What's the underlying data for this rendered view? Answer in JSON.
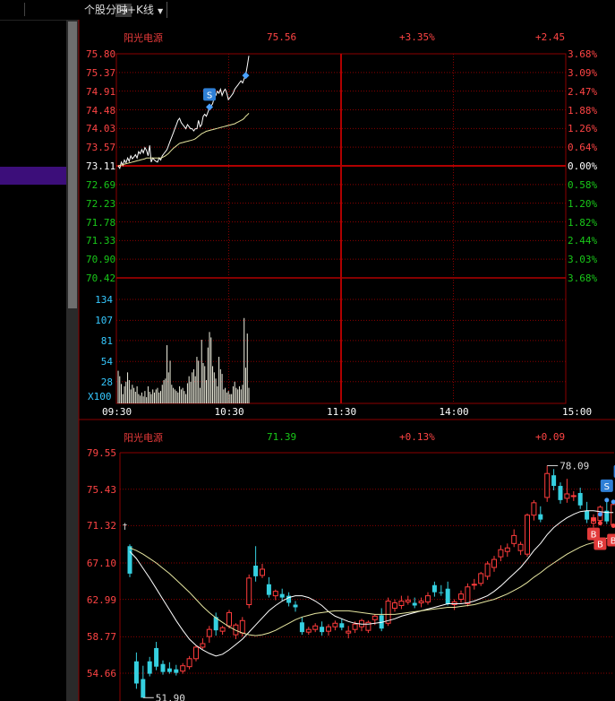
{
  "toolbar": {
    "toggle_icon": "panel-toggle-icon",
    "title": "个股分时+K线",
    "dropdown_icon": "chevron-down-icon"
  },
  "intraday": {
    "stock_name": "阳光电源",
    "price": "75.56",
    "change_pct": "+3.35%",
    "change_abs": "+2.45",
    "price_ticks": [
      "75.80",
      "75.37",
      "74.91",
      "74.48",
      "74.03",
      "73.57",
      "73.11",
      "72.69",
      "72.23",
      "71.78",
      "71.33",
      "70.90",
      "70.42"
    ],
    "pct_ticks": [
      "3.68%",
      "3.09%",
      "2.47%",
      "1.88%",
      "1.26%",
      "0.64%",
      "0.00%",
      "0.58%",
      "1.20%",
      "1.82%",
      "2.44%",
      "3.03%",
      "3.68%"
    ],
    "volume_ticks": [
      "134",
      "107",
      "81",
      "54",
      "28"
    ],
    "volume_unit": "X100",
    "time_ticks": [
      "09:30",
      "10:30",
      "11:30",
      "14:00",
      "15:00"
    ],
    "sell_marker": "S",
    "price_line": [
      73.11,
      73.05,
      73.2,
      73.12,
      73.25,
      73.18,
      73.3,
      73.22,
      73.35,
      73.28,
      73.32,
      73.38,
      73.3,
      73.45,
      73.4,
      73.5,
      73.42,
      73.55,
      73.48,
      73.35,
      73.6,
      73.2,
      73.3,
      73.25,
      73.22,
      73.2,
      73.3,
      73.25,
      73.35,
      73.4,
      73.45,
      73.5,
      73.6,
      73.7,
      73.8,
      73.9,
      74.0,
      74.1,
      74.2,
      74.25,
      74.15,
      74.1,
      74.05,
      74.0,
      74.1,
      74.05,
      74.0,
      74.0,
      73.95,
      74.0,
      74.0,
      74.2,
      74.05,
      74.1,
      74.3,
      74.35,
      74.3,
      74.4,
      74.5,
      74.55,
      74.6,
      74.75,
      74.8,
      74.9,
      74.85,
      74.95,
      74.8,
      74.9,
      74.95,
      74.85,
      74.7,
      74.75,
      74.8,
      74.85,
      74.95,
      75.0,
      75.05,
      75.1,
      75.15,
      75.1,
      75.2,
      75.3,
      75.5,
      75.75
    ],
    "avg_line": [
      73.11,
      73.12,
      73.13,
      73.14,
      73.15,
      73.16,
      73.17,
      73.18,
      73.19,
      73.2,
      73.21,
      73.22,
      73.23,
      73.24,
      73.25,
      73.26,
      73.27,
      73.28,
      73.3,
      73.3,
      73.3,
      73.3,
      73.3,
      73.3,
      73.3,
      73.3,
      73.3,
      73.3,
      73.31,
      73.33,
      73.35,
      73.38,
      73.41,
      73.45,
      73.49,
      73.53,
      73.56,
      73.59,
      73.62,
      73.65,
      73.66,
      73.67,
      73.68,
      73.69,
      73.7,
      73.71,
      73.72,
      73.73,
      73.74,
      73.76,
      73.79,
      73.82,
      73.85,
      73.88,
      73.9,
      73.92,
      73.94,
      73.95,
      73.96,
      73.97,
      73.98,
      73.99,
      74.0,
      74.01,
      74.02,
      74.03,
      74.04,
      74.05,
      74.06,
      74.07,
      74.08,
      74.09,
      74.1,
      74.11,
      74.12,
      74.14,
      74.16,
      74.18,
      74.2,
      74.22,
      74.25,
      74.3,
      74.33,
      74.37
    ],
    "volumes": [
      42,
      35,
      25,
      12,
      22,
      28,
      40,
      30,
      18,
      24,
      20,
      15,
      22,
      12,
      10,
      14,
      9,
      16,
      8,
      22,
      15,
      12,
      18,
      14,
      18,
      20,
      14,
      16,
      24,
      30,
      32,
      75,
      40,
      55,
      24,
      20,
      18,
      16,
      14,
      22,
      18,
      20,
      16,
      12,
      26,
      35,
      28,
      40,
      44,
      35,
      60,
      55,
      20,
      82,
      52,
      48,
      30,
      72,
      92,
      85,
      48,
      40,
      32,
      22,
      60,
      44,
      38,
      18,
      20,
      14,
      16,
      12,
      12,
      22,
      28,
      20,
      18,
      22,
      18,
      24,
      110,
      46,
      90,
      20
    ]
  },
  "kline": {
    "stock_name": "阳光电源",
    "price": "71.39",
    "change_pct": "+0.13%",
    "change_abs": "+0.09",
    "price_ticks": [
      "79.55",
      "75.43",
      "71.32",
      "67.10",
      "62.99",
      "58.77",
      "54.66"
    ],
    "high_label": "78.09",
    "low_label": "51.90",
    "buy_marker": "B",
    "sell_marker": "S",
    "candles": [
      [
        69.0,
        69.2,
        65.9,
        65.5
      ],
      [
        56.0,
        57.0,
        53.5,
        52.9
      ],
      [
        54.0,
        55.5,
        51.9,
        51.9
      ],
      [
        56.0,
        56.5,
        54.6,
        54.3
      ],
      [
        57.5,
        58.2,
        55.4,
        55.0
      ],
      [
        55.7,
        56.1,
        54.8,
        54.5
      ],
      [
        55.2,
        55.9,
        54.8,
        54.6
      ],
      [
        55.1,
        55.6,
        54.7,
        54.4
      ],
      [
        54.9,
        55.8,
        55.5,
        54.6
      ],
      [
        55.4,
        56.6,
        56.3,
        55.1
      ],
      [
        56.3,
        57.8,
        57.6,
        56.0
      ],
      [
        57.6,
        58.6,
        58.0,
        57.4
      ],
      [
        58.8,
        60.0,
        59.6,
        58.1
      ],
      [
        61.0,
        61.5,
        59.5,
        58.9
      ],
      [
        59.4,
        60.0,
        59.8,
        59.0
      ],
      [
        60.0,
        61.8,
        61.5,
        59.7
      ],
      [
        59.0,
        60.3,
        60.1,
        58.5
      ],
      [
        59.2,
        61.0,
        60.6,
        58.8
      ],
      [
        62.4,
        65.8,
        65.4,
        62.0
      ],
      [
        66.8,
        69.0,
        65.6,
        65.0
      ],
      [
        65.7,
        67.0,
        66.4,
        65.4
      ],
      [
        64.7,
        65.5,
        63.5,
        63.2
      ],
      [
        63.4,
        64.1,
        63.9,
        62.9
      ],
      [
        63.6,
        64.2,
        63.2,
        62.8
      ],
      [
        63.4,
        63.8,
        62.6,
        62.2
      ],
      [
        62.4,
        62.8,
        62.1,
        61.6
      ],
      [
        60.4,
        61.0,
        59.3,
        59.0
      ],
      [
        59.3,
        59.9,
        59.6,
        59.0
      ],
      [
        59.6,
        60.3,
        60.0,
        59.3
      ],
      [
        59.9,
        60.5,
        59.3,
        58.9
      ],
      [
        59.4,
        60.2,
        59.9,
        58.9
      ],
      [
        59.9,
        60.6,
        60.3,
        59.5
      ],
      [
        60.3,
        60.8,
        59.8,
        59.5
      ],
      [
        59.2,
        60.0,
        59.4,
        58.6
      ],
      [
        59.6,
        60.5,
        60.2,
        59.2
      ],
      [
        59.9,
        60.8,
        60.6,
        59.4
      ],
      [
        59.5,
        60.6,
        60.4,
        59.2
      ],
      [
        60.7,
        61.3,
        61.1,
        60.1
      ],
      [
        61.2,
        62.0,
        59.7,
        59.4
      ],
      [
        60.3,
        63.2,
        62.8,
        60.0
      ],
      [
        62.0,
        63.0,
        62.6,
        61.6
      ],
      [
        62.3,
        63.4,
        62.8,
        61.9
      ],
      [
        62.7,
        63.4,
        62.9,
        62.4
      ],
      [
        62.6,
        63.2,
        62.3,
        62.0
      ],
      [
        62.6,
        63.2,
        62.8,
        62.1
      ],
      [
        62.7,
        63.8,
        63.4,
        62.4
      ],
      [
        64.6,
        65.0,
        63.8,
        63.3
      ],
      [
        63.8,
        64.6,
        63.7,
        63.4
      ],
      [
        64.2,
        65.0,
        62.5,
        62.3
      ],
      [
        62.4,
        63.0,
        62.7,
        61.8
      ],
      [
        63.0,
        64.0,
        63.6,
        62.6
      ],
      [
        62.5,
        64.8,
        64.4,
        62.2
      ],
      [
        64.6,
        65.3,
        64.7,
        64.1
      ],
      [
        64.8,
        66.1,
        65.9,
        64.5
      ],
      [
        65.6,
        67.3,
        67.0,
        65.2
      ],
      [
        66.6,
        67.9,
        67.5,
        66.1
      ],
      [
        67.8,
        69.1,
        68.6,
        67.3
      ],
      [
        68.4,
        69.3,
        68.8,
        67.8
      ],
      [
        69.3,
        70.9,
        70.2,
        68.9
      ],
      [
        68.5,
        69.5,
        69.2,
        68.0
      ],
      [
        68.1,
        72.7,
        72.5,
        67.8
      ],
      [
        72.5,
        74.2,
        73.9,
        71.9
      ],
      [
        72.6,
        73.5,
        72.0,
        71.7
      ],
      [
        74.5,
        78.09,
        77.2,
        74.0
      ],
      [
        77.0,
        77.7,
        75.8,
        75.3
      ],
      [
        75.8,
        76.2,
        74.2,
        73.8
      ],
      [
        74.4,
        76.6,
        74.9,
        73.9
      ],
      [
        74.6,
        75.2,
        74.7,
        74.1
      ],
      [
        75.0,
        75.6,
        73.6,
        73.2
      ],
      [
        73.0,
        74.0,
        72.0,
        71.6
      ],
      [
        71.6,
        72.6,
        72.2,
        71.1
      ],
      [
        71.9,
        73.6,
        73.4,
        71.5
      ],
      [
        73.0,
        74.2,
        71.8,
        71.5
      ],
      [
        71.4,
        74.2,
        73.7,
        71.3
      ]
    ],
    "ma_fast": [
      68.4,
      67.6,
      66.5,
      65.4,
      64.2,
      63.0,
      61.8,
      60.6,
      59.5,
      58.5,
      57.8,
      57.3,
      56.9,
      56.6,
      56.8,
      57.3,
      57.9,
      58.5,
      59.3,
      60.1,
      60.9,
      61.7,
      62.3,
      62.8,
      63.2,
      63.4,
      63.4,
      63.2,
      62.8,
      62.3,
      61.6,
      61.1,
      60.8,
      60.5,
      60.3,
      60.2,
      60.2,
      60.3,
      60.4,
      60.6,
      60.8,
      61.1,
      61.3,
      61.5,
      61.7,
      61.9,
      62.1,
      62.3,
      62.5,
      62.5,
      62.5,
      62.6,
      62.8,
      63.1,
      63.4,
      63.9,
      64.5,
      65.2,
      65.9,
      66.6,
      67.5,
      68.5,
      69.3,
      70.3,
      71.1,
      71.7,
      72.2,
      72.6,
      72.9,
      73.0,
      73.0,
      72.9,
      72.8,
      72.8
    ],
    "ma_slow": [
      68.8,
      68.5,
      68.1,
      67.6,
      67.1,
      66.5,
      65.9,
      65.2,
      64.5,
      63.8,
      63.0,
      62.2,
      61.5,
      60.9,
      60.4,
      59.9,
      59.5,
      59.2,
      59.0,
      58.9,
      59.0,
      59.2,
      59.5,
      59.9,
      60.3,
      60.7,
      61.0,
      61.2,
      61.4,
      61.5,
      61.6,
      61.7,
      61.7,
      61.7,
      61.6,
      61.5,
      61.4,
      61.3,
      61.3,
      61.3,
      61.3,
      61.4,
      61.5,
      61.6,
      61.7,
      61.8,
      61.9,
      62.0,
      62.1,
      62.1,
      62.2,
      62.3,
      62.4,
      62.6,
      62.8,
      63.0,
      63.3,
      63.6,
      64.0,
      64.4,
      64.9,
      65.5,
      66.0,
      66.6,
      67.1,
      67.6,
      68.1,
      68.5,
      68.9,
      69.2,
      69.4,
      69.7,
      69.9,
      70.1
    ]
  },
  "colors": {
    "up": "#ff3c3c",
    "down": "#35d0e0",
    "grid": "#8b0000",
    "avg_line": "#e6e6a0",
    "price_line": "#ffffff",
    "marker_s": "#2f7fd6",
    "marker_b": "#e23a3a",
    "left_highlight": "#3c0e7a"
  }
}
